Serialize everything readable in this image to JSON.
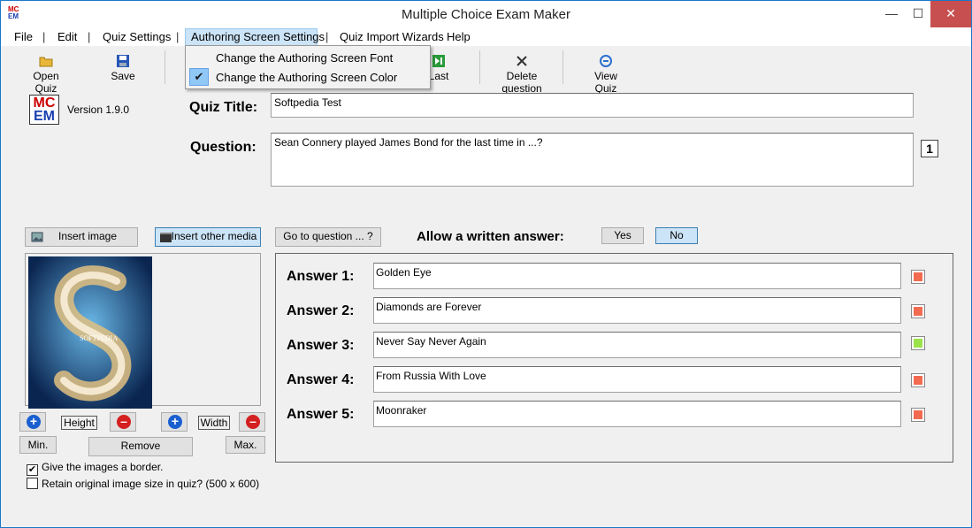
{
  "window": {
    "title": "Multiple Choice Exam Maker",
    "minimize": "—",
    "maximize": "☐",
    "close": "✕"
  },
  "app_icon": {
    "top": "MC",
    "bottom": "EM"
  },
  "menu": {
    "file": "File",
    "sep": "|",
    "edit": "Edit",
    "quiz_settings": "Quiz Settings",
    "authoring_screen_settings": "Authoring Screen Settings",
    "quiz_import_wizards": "Quiz Import Wizards",
    "help": "Help"
  },
  "dropdown": {
    "items": [
      "Change the Authoring Screen Font",
      "Change the Authoring Screen Color"
    ],
    "checked_mark": "✔"
  },
  "toolbar": {
    "open": "Open Quiz",
    "save": "Save",
    "last": "Last",
    "delete": "Delete question",
    "view": "View Quiz"
  },
  "logo": {
    "top": "MC",
    "bottom": "EM"
  },
  "version": "Version 1.9.0",
  "quiz_title": {
    "label": "Quiz Title:",
    "value": "Softpedia Test"
  },
  "question": {
    "label": "Question:",
    "value": "Sean Connery played James Bond for the last time in ...?",
    "number": "1"
  },
  "media": {
    "insert_image": "Insert image",
    "insert_other_media": "Insert other media",
    "goto_question": "Go to question ... ?"
  },
  "written_answer": {
    "label": "Allow a written answer:",
    "yes": "Yes",
    "no": "No"
  },
  "answers": [
    {
      "label": "Answer 1:",
      "text": "Golden Eye",
      "correct": false
    },
    {
      "label": "Answer 2:",
      "text": "Diamonds are Forever",
      "correct": false
    },
    {
      "label": "Answer 3:",
      "text": "Never Say Never Again",
      "correct": true
    },
    {
      "label": "Answer 4:",
      "text": "From Russia With Love",
      "correct": false
    },
    {
      "label": "Answer 5:",
      "text": "Moonraker",
      "correct": false
    }
  ],
  "image_controls": {
    "height": "Height",
    "width": "Width",
    "min": "Min.",
    "remove": "Remove",
    "max": "Max.",
    "plus": "+",
    "minus": "–"
  },
  "image_preview": {
    "watermark": "SOFTPEDIA"
  },
  "options": {
    "border": {
      "label": "Give the images a border.",
      "checked": true
    },
    "retain": {
      "label": "Retain original image size in quiz? (500 x 600)",
      "checked": false
    }
  },
  "colors": {
    "wrong": "#f26a4f",
    "correct": "#9be34a",
    "accent": "#cce4f7"
  }
}
